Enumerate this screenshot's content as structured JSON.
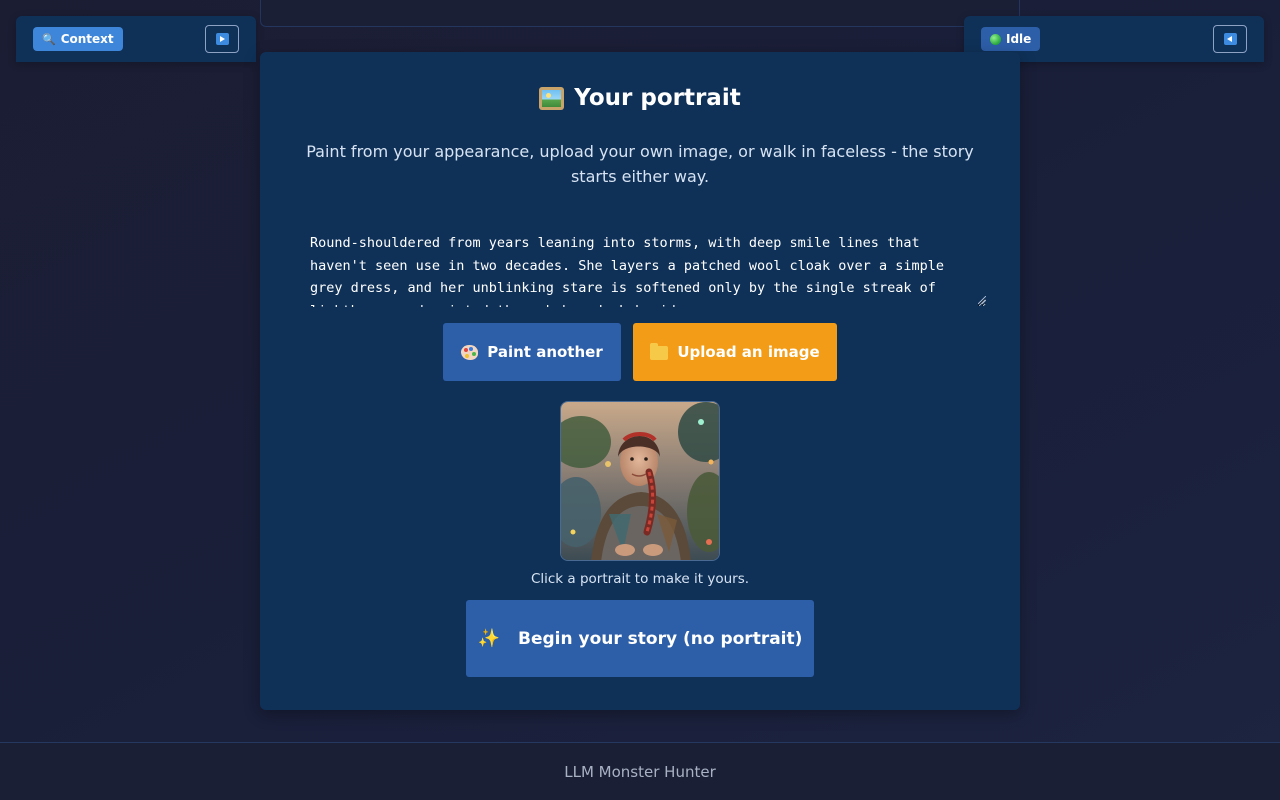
{
  "left_panel": {
    "context_label": "Context",
    "context_icon": "magnifier-icon",
    "toggle_icon": "play-right-icon"
  },
  "right_panel": {
    "status_label": "Idle",
    "status_color": "#27a83c",
    "toggle_icon": "play-left-icon"
  },
  "card": {
    "title": "Your portrait",
    "title_icon": "framed-picture-icon",
    "subtitle": "Paint from your appearance, upload your own image, or walk in faceless - the story starts either way.",
    "description": "Round-shouldered from years leaning into storms, with deep smile lines that haven't seen use in two decades. She layers a patched wool cloak over a simple grey dress, and her unblinking stare is softened only by the single streak of lighthouse-red painted through her dark braid.",
    "paint_button": "Paint another",
    "upload_button": "Upload an image",
    "portrait_hint": "Click a portrait to make it yours.",
    "begin_button": "Begin your story (no portrait)"
  },
  "footer": {
    "text": "LLM Monster Hunter"
  },
  "colors": {
    "background": "#1a1f3a",
    "card": "#0f3158",
    "primary_button": "#2d5ea8",
    "accent_button": "#f29c17",
    "context_pill": "#3e86da"
  }
}
